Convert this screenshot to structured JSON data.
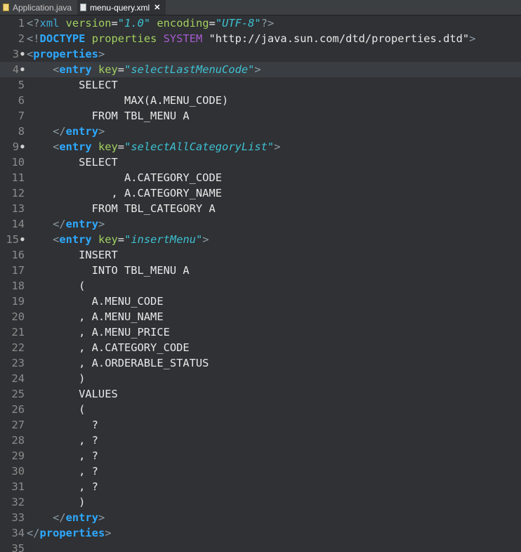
{
  "tabs": [
    {
      "label": "Application.java",
      "active": false,
      "icon": "java-file-icon"
    },
    {
      "label": "menu-query.xml",
      "active": true,
      "icon": "xml-file-icon",
      "close": "✕"
    }
  ],
  "lines": [
    {
      "n": "1",
      "fold": "",
      "tokens": [
        {
          "c": "br",
          "t": "<?"
        },
        {
          "c": "pi",
          "t": "xml"
        },
        {
          "c": "attr",
          "t": " version"
        },
        {
          "c": "str",
          "t": "="
        },
        {
          "c": "val",
          "t": "\"1.0\""
        },
        {
          "c": "attr",
          "t": " encoding"
        },
        {
          "c": "str",
          "t": "="
        },
        {
          "c": "val",
          "t": "\"UTF-8\""
        },
        {
          "c": "br",
          "t": "?>"
        }
      ]
    },
    {
      "n": "2",
      "fold": "",
      "tokens": [
        {
          "c": "br",
          "t": "<!"
        },
        {
          "c": "tag",
          "t": "DOCTYPE"
        },
        {
          "c": "attr",
          "t": " properties "
        },
        {
          "c": "doctype",
          "t": "SYSTEM"
        },
        {
          "c": "str",
          "t": " \"http://java.sun.com/dtd/properties.dtd\""
        },
        {
          "c": "br",
          "t": ">"
        }
      ]
    },
    {
      "n": "3",
      "fold": "●",
      "tokens": [
        {
          "c": "br",
          "t": "<"
        },
        {
          "c": "tag",
          "t": "properties"
        },
        {
          "c": "br",
          "t": ">"
        }
      ]
    },
    {
      "n": "4",
      "fold": "●",
      "hl": true,
      "tokens": [
        {
          "c": "",
          "t": "    "
        },
        {
          "c": "br",
          "t": "<"
        },
        {
          "c": "tag",
          "t": "entry"
        },
        {
          "c": "attr",
          "t": " key"
        },
        {
          "c": "str",
          "t": "="
        },
        {
          "c": "val",
          "t": "\"selectLastMenuCode\""
        },
        {
          "c": "br",
          "t": ">"
        }
      ]
    },
    {
      "n": "5",
      "fold": "",
      "tokens": [
        {
          "c": "",
          "t": "        SELECT"
        }
      ]
    },
    {
      "n": "6",
      "fold": "",
      "tokens": [
        {
          "c": "",
          "t": "               MAX(A.MENU_CODE)"
        }
      ]
    },
    {
      "n": "7",
      "fold": "",
      "tokens": [
        {
          "c": "",
          "t": "          FROM TBL_MENU A"
        }
      ]
    },
    {
      "n": "8",
      "fold": "",
      "tokens": [
        {
          "c": "",
          "t": "    "
        },
        {
          "c": "br",
          "t": "</"
        },
        {
          "c": "tag",
          "t": "entry"
        },
        {
          "c": "br",
          "t": ">"
        }
      ]
    },
    {
      "n": "9",
      "fold": "●",
      "tokens": [
        {
          "c": "",
          "t": "    "
        },
        {
          "c": "br",
          "t": "<"
        },
        {
          "c": "tag",
          "t": "entry"
        },
        {
          "c": "attr",
          "t": " key"
        },
        {
          "c": "str",
          "t": "="
        },
        {
          "c": "val",
          "t": "\"selectAllCategoryList\""
        },
        {
          "c": "br",
          "t": ">"
        }
      ]
    },
    {
      "n": "10",
      "fold": "",
      "tokens": [
        {
          "c": "",
          "t": "        SELECT"
        }
      ]
    },
    {
      "n": "11",
      "fold": "",
      "tokens": [
        {
          "c": "",
          "t": "               A.CATEGORY_CODE"
        }
      ]
    },
    {
      "n": "12",
      "fold": "",
      "tokens": [
        {
          "c": "",
          "t": "             , A.CATEGORY_NAME"
        }
      ]
    },
    {
      "n": "13",
      "fold": "",
      "tokens": [
        {
          "c": "",
          "t": "          FROM TBL_CATEGORY A"
        }
      ]
    },
    {
      "n": "14",
      "fold": "",
      "tokens": [
        {
          "c": "",
          "t": "    "
        },
        {
          "c": "br",
          "t": "</"
        },
        {
          "c": "tag",
          "t": "entry"
        },
        {
          "c": "br",
          "t": ">"
        }
      ]
    },
    {
      "n": "15",
      "fold": "●",
      "tokens": [
        {
          "c": "",
          "t": "    "
        },
        {
          "c": "br",
          "t": "<"
        },
        {
          "c": "tag",
          "t": "entry"
        },
        {
          "c": "attr",
          "t": " key"
        },
        {
          "c": "str",
          "t": "="
        },
        {
          "c": "val",
          "t": "\"insertMenu\""
        },
        {
          "c": "br",
          "t": ">"
        }
      ]
    },
    {
      "n": "16",
      "fold": "",
      "tokens": [
        {
          "c": "",
          "t": "        INSERT"
        }
      ]
    },
    {
      "n": "17",
      "fold": "",
      "tokens": [
        {
          "c": "",
          "t": "          INTO TBL_MENU A"
        }
      ]
    },
    {
      "n": "18",
      "fold": "",
      "tokens": [
        {
          "c": "",
          "t": "        ("
        }
      ]
    },
    {
      "n": "19",
      "fold": "",
      "tokens": [
        {
          "c": "",
          "t": "          A.MENU_CODE"
        }
      ]
    },
    {
      "n": "20",
      "fold": "",
      "tokens": [
        {
          "c": "",
          "t": "        , A.MENU_NAME"
        }
      ]
    },
    {
      "n": "21",
      "fold": "",
      "tokens": [
        {
          "c": "",
          "t": "        , A.MENU_PRICE"
        }
      ]
    },
    {
      "n": "22",
      "fold": "",
      "tokens": [
        {
          "c": "",
          "t": "        , A.CATEGORY_CODE"
        }
      ]
    },
    {
      "n": "23",
      "fold": "",
      "tokens": [
        {
          "c": "",
          "t": "        , A.ORDERABLE_STATUS"
        }
      ]
    },
    {
      "n": "24",
      "fold": "",
      "tokens": [
        {
          "c": "",
          "t": "        )"
        }
      ]
    },
    {
      "n": "25",
      "fold": "",
      "tokens": [
        {
          "c": "",
          "t": "        VALUES"
        }
      ]
    },
    {
      "n": "26",
      "fold": "",
      "tokens": [
        {
          "c": "",
          "t": "        ("
        }
      ]
    },
    {
      "n": "27",
      "fold": "",
      "tokens": [
        {
          "c": "",
          "t": "          ?"
        }
      ]
    },
    {
      "n": "28",
      "fold": "",
      "tokens": [
        {
          "c": "",
          "t": "        , ?"
        }
      ]
    },
    {
      "n": "29",
      "fold": "",
      "tokens": [
        {
          "c": "",
          "t": "        , ?"
        }
      ]
    },
    {
      "n": "30",
      "fold": "",
      "tokens": [
        {
          "c": "",
          "t": "        , ?"
        }
      ]
    },
    {
      "n": "31",
      "fold": "",
      "tokens": [
        {
          "c": "",
          "t": "        , ?"
        }
      ]
    },
    {
      "n": "32",
      "fold": "",
      "tokens": [
        {
          "c": "",
          "t": "        )"
        }
      ]
    },
    {
      "n": "33",
      "fold": "",
      "tokens": [
        {
          "c": "",
          "t": "    "
        },
        {
          "c": "br",
          "t": "</"
        },
        {
          "c": "tag",
          "t": "entry"
        },
        {
          "c": "br",
          "t": ">"
        }
      ]
    },
    {
      "n": "34",
      "fold": "",
      "tokens": [
        {
          "c": "br",
          "t": "</"
        },
        {
          "c": "tag",
          "t": "properties"
        },
        {
          "c": "br",
          "t": ">"
        }
      ]
    },
    {
      "n": "35",
      "fold": "",
      "tokens": []
    }
  ]
}
